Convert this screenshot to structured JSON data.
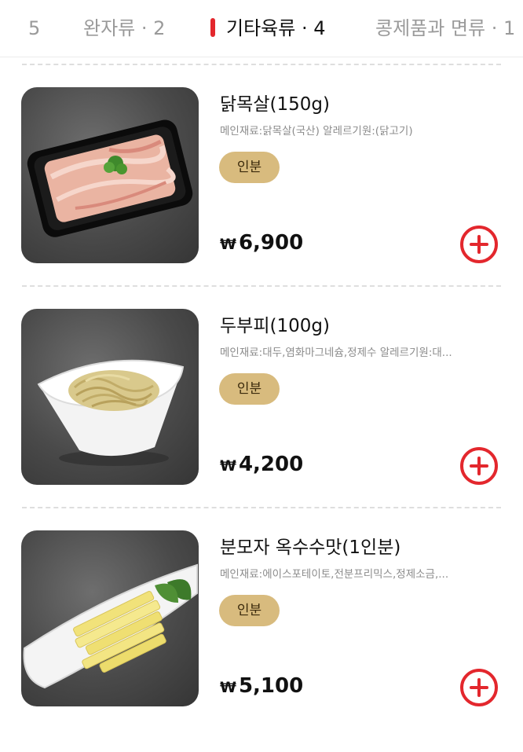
{
  "tabs": [
    {
      "label": "5",
      "active": false
    },
    {
      "label": "완자류 · 2",
      "active": false
    },
    {
      "label": "기타육류 · 4",
      "active": true
    },
    {
      "label": "콩제품과 면류 · 1",
      "active": false
    }
  ],
  "items": [
    {
      "name": "닭목살(150g)",
      "description": "메인재료:닭목살(국산) 알레르기원:(닭고기)",
      "badge": "인분",
      "currency": "₩",
      "price": "6,900",
      "image": "chicken-neck-on-black-tray"
    },
    {
      "name": "두부피(100g)",
      "description": "메인재료:대두,염화마그네슘,정제수 알레르기원:대...",
      "badge": "인분",
      "currency": "₩",
      "price": "4,200",
      "image": "tofu-skin-noodles-in-white-bowl"
    },
    {
      "name": "분모자 옥수수맛(1인분)",
      "description": "메인재료:에이스포테이토,전분프리믹스,정제소금,...",
      "badge": "인분",
      "currency": "₩",
      "price": "5,100",
      "image": "corn-bunmoja-sticks-on-white-dish"
    }
  ],
  "colors": {
    "accent": "#e3272d",
    "badge": "#d8bb7e",
    "active_tab": "#111111",
    "inactive_tab": "#9a9a9a"
  }
}
